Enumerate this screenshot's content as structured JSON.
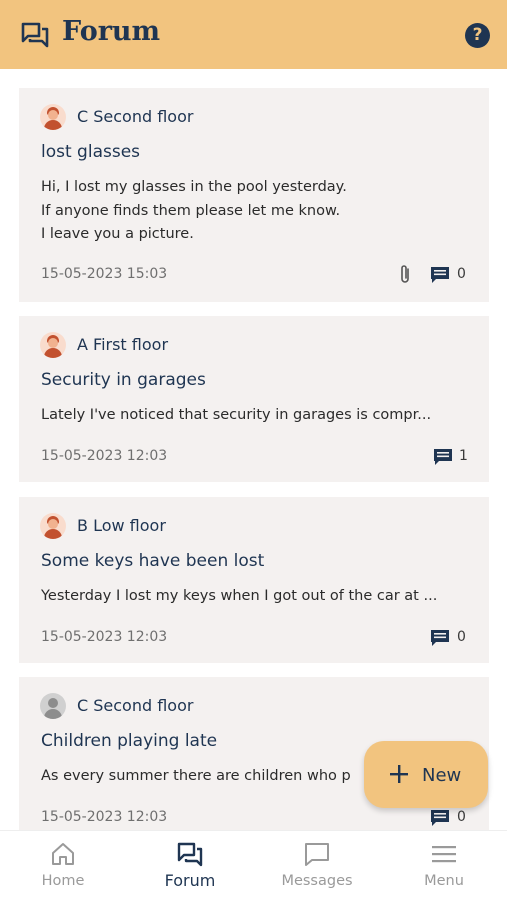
{
  "header": {
    "title": "Forum",
    "help_label": "?",
    "icons": {
      "forum": "forum-chat-icon",
      "help": "help-circle-icon"
    }
  },
  "posts": [
    {
      "author": "C Second floor",
      "title": "lost glasses",
      "body": [
        "Hi, I lost my glasses in the pool yesterday.",
        "If anyone finds them please let me know.",
        "I leave you a picture."
      ],
      "date": "15-05-2023 15:03",
      "has_attachment": true,
      "comments": "0",
      "avatar": "red-haired-person"
    },
    {
      "author": "A First floor",
      "title": "Security in garages",
      "body": [
        "Lately I've noticed that security in garages is compr..."
      ],
      "date": "15-05-2023 12:03",
      "has_attachment": false,
      "comments": "1",
      "avatar": "red-haired-person"
    },
    {
      "author": "B Low floor",
      "title": "Some keys have been lost",
      "body": [
        "Yesterday I lost my keys when I got out of the car at ..."
      ],
      "date": "15-05-2023 12:03",
      "has_attachment": false,
      "comments": "0",
      "avatar": "red-haired-person"
    },
    {
      "author": "C Second floor",
      "title": "Children playing late",
      "body": [
        "As every summer there are children who p"
      ],
      "date": "15-05-2023 12:03",
      "has_attachment": false,
      "comments": "0",
      "avatar": "gray-person"
    }
  ],
  "fab": {
    "label": "New",
    "icon": "plus-icon"
  },
  "bottom_nav": [
    {
      "label": "Home",
      "icon": "home-icon",
      "active": false
    },
    {
      "label": "Forum",
      "icon": "forum-chat-icon",
      "active": true
    },
    {
      "label": "Messages",
      "icon": "message-bubble-icon",
      "active": false
    },
    {
      "label": "Menu",
      "icon": "hamburger-menu-icon",
      "active": false
    }
  ],
  "colors": {
    "header_bg": "#f2c47f",
    "card_bg": "#f4f1f0",
    "text_dark": "#1f3552",
    "nav_inactive": "#9a9a9a"
  }
}
